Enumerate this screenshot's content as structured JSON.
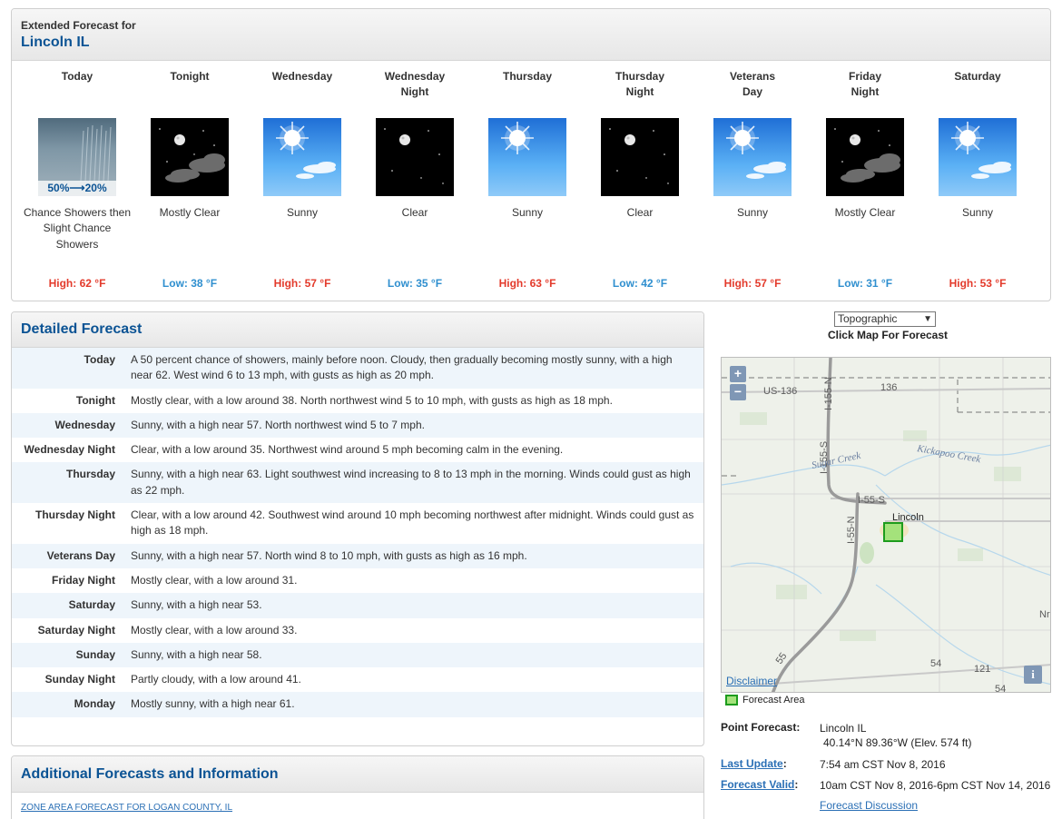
{
  "header": {
    "small_title": "Extended Forecast for",
    "location": "Lincoln IL"
  },
  "periods": [
    {
      "name": "Today",
      "name2": "",
      "icon": "rain-showers-icon",
      "pop_from": "50%",
      "pop_arrow": "⟶",
      "pop_to": "20%",
      "desc": "Chance Showers then Slight Chance Showers",
      "temp": "High: 62 °F",
      "kind": "high"
    },
    {
      "name": "Tonight",
      "name2": "",
      "icon": "mostly-clear-night-icon",
      "desc": "Mostly Clear",
      "temp": "Low: 38 °F",
      "kind": "low"
    },
    {
      "name": "Wednesday",
      "name2": "",
      "icon": "sunny-icon",
      "desc": "Sunny",
      "temp": "High: 57 °F",
      "kind": "high"
    },
    {
      "name": "Wednesday",
      "name2": "Night",
      "icon": "clear-night-icon",
      "desc": "Clear",
      "temp": "Low: 35 °F",
      "kind": "low"
    },
    {
      "name": "Thursday",
      "name2": "",
      "icon": "sunny-icon",
      "desc": "Sunny",
      "temp": "High: 63 °F",
      "kind": "high"
    },
    {
      "name": "Thursday",
      "name2": "Night",
      "icon": "clear-night-icon",
      "desc": "Clear",
      "temp": "Low: 42 °F",
      "kind": "low"
    },
    {
      "name": "Veterans",
      "name2": "Day",
      "icon": "sunny-icon",
      "desc": "Sunny",
      "temp": "High: 57 °F",
      "kind": "high"
    },
    {
      "name": "Friday",
      "name2": "Night",
      "icon": "mostly-clear-night-icon",
      "desc": "Mostly Clear",
      "temp": "Low: 31 °F",
      "kind": "low"
    },
    {
      "name": "Saturday",
      "name2": "",
      "icon": "sunny-icon",
      "desc": "Sunny",
      "temp": "High: 53 °F",
      "kind": "high"
    }
  ],
  "detailed": {
    "title": "Detailed Forecast",
    "rows": [
      {
        "label": "Today",
        "text": "A 50 percent chance of showers, mainly before noon. Cloudy, then gradually becoming mostly sunny, with a high near 62. West wind 6 to 13 mph, with gusts as high as 20 mph."
      },
      {
        "label": "Tonight",
        "text": "Mostly clear, with a low around 38. North northwest wind 5 to 10 mph, with gusts as high as 18 mph."
      },
      {
        "label": "Wednesday",
        "text": "Sunny, with a high near 57. North northwest wind 5 to 7 mph."
      },
      {
        "label": "Wednesday Night",
        "text": "Clear, with a low around 35. Northwest wind around 5 mph becoming calm in the evening."
      },
      {
        "label": "Thursday",
        "text": "Sunny, with a high near 63. Light southwest wind increasing to 8 to 13 mph in the morning. Winds could gust as high as 22 mph."
      },
      {
        "label": "Thursday Night",
        "text": "Clear, with a low around 42. Southwest wind around 10 mph becoming northwest after midnight. Winds could gust as high as 18 mph."
      },
      {
        "label": "Veterans Day",
        "text": "Sunny, with a high near 57. North wind 8 to 10 mph, with gusts as high as 16 mph."
      },
      {
        "label": "Friday Night",
        "text": "Mostly clear, with a low around 31."
      },
      {
        "label": "Saturday",
        "text": "Sunny, with a high near 53."
      },
      {
        "label": "Saturday Night",
        "text": "Mostly clear, with a low around 33."
      },
      {
        "label": "Sunday",
        "text": "Sunny, with a high near 58."
      },
      {
        "label": "Sunday Night",
        "text": "Partly cloudy, with a low around 41."
      },
      {
        "label": "Monday",
        "text": "Mostly sunny, with a high near 61."
      }
    ]
  },
  "additional": {
    "title": "Additional Forecasts and Information",
    "zone_link": "ZONE AREA FORECAST FOR LOGAN COUNTY, IL"
  },
  "map": {
    "select_value": "Topographic",
    "caption": "Click Map For Forecast",
    "zoom_in": "+",
    "zoom_out": "−",
    "info": "i",
    "disclaimer": "Disclaimer",
    "legend": "Forecast Area",
    "labels": {
      "us136": "US-136",
      "r136": "136",
      "i155n": "I-155-N",
      "i155s": "I-155-S",
      "i55s": "I-55-S",
      "i55n": "I-55-N",
      "sugar": "Sugar Creek",
      "kickapoo": "Kickapoo Creek",
      "lincoln": "Lincoln",
      "r55": "55",
      "r54a": "54",
      "r54b": "54",
      "r121": "121",
      "nr": "Nr"
    }
  },
  "point": {
    "label": "Point Forecast:",
    "place": "Lincoln IL",
    "coords": "40.14°N 89.36°W (Elev. 574 ft)",
    "last_update_label": "Last Update",
    "last_update_colon": ":",
    "last_update": "7:54 am CST Nov 8, 2016",
    "valid_label": "Forecast Valid",
    "valid_colon": ":",
    "valid": "10am CST Nov 8, 2016-6pm CST Nov 14, 2016",
    "discussion": "Forecast Discussion"
  },
  "colors": {
    "high": "#e33a2b",
    "low": "#2f8fcf",
    "accent": "#0b5394",
    "link": "#2a6fb5",
    "forecast_area": "#a4e27b"
  }
}
